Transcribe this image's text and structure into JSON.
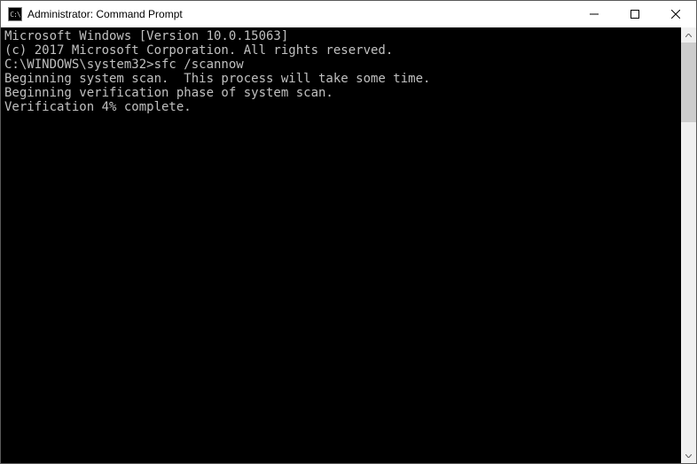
{
  "title": "Administrator: Command Prompt",
  "icon_text": "C:\\",
  "terminal": {
    "line1": "Microsoft Windows [Version 10.0.15063]",
    "line2": "(c) 2017 Microsoft Corporation. All rights reserved.",
    "blank1": "",
    "prompt": "C:\\WINDOWS\\system32>",
    "command": "sfc /scannow",
    "blank2": "",
    "msg1": "Beginning system scan.  This process will take some time.",
    "blank3": "",
    "msg2": "Beginning verification phase of system scan.",
    "msg3": "Verification 4% complete."
  }
}
